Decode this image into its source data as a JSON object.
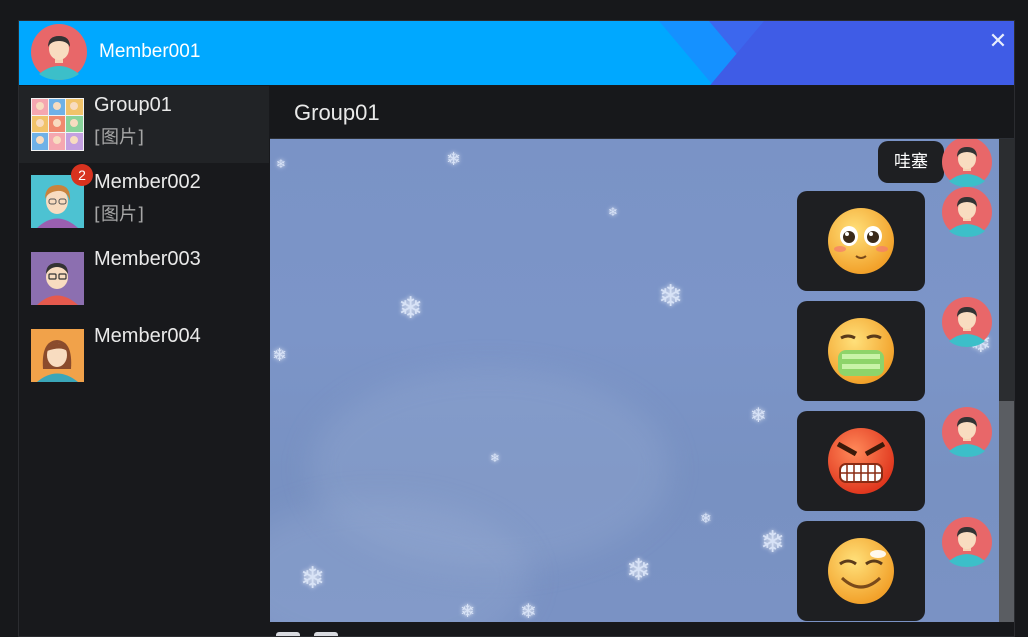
{
  "header": {
    "title": "Member001",
    "close_icon": "close-icon",
    "colors": {
      "primary": "#00a8ff",
      "accent": "#3c67ee"
    }
  },
  "sidebar": {
    "contacts": [
      {
        "name": "Group01",
        "last_message": "[图片]",
        "unread": "",
        "avatar": "group-avatar-icon",
        "active": true
      },
      {
        "name": "Member002",
        "last_message": "[图片]",
        "unread": "2",
        "avatar": "member-avatar-icon",
        "active": false
      },
      {
        "name": "Member003",
        "last_message": "",
        "unread": "",
        "avatar": "member-avatar-icon",
        "active": false
      },
      {
        "name": "Member004",
        "last_message": "",
        "unread": "",
        "avatar": "member-avatar-icon",
        "active": false
      }
    ]
  },
  "chat": {
    "title": "Group01",
    "messages": [
      {
        "type": "text",
        "text": "哇塞"
      },
      {
        "type": "emoji",
        "emoji": "pleading-face-emoji"
      },
      {
        "type": "emoji",
        "emoji": "sick-vomiting-emoji"
      },
      {
        "type": "emoji",
        "emoji": "angry-face-emoji"
      },
      {
        "type": "emoji",
        "emoji": "smug-grin-emoji"
      }
    ],
    "background": "snowflake-wallpaper"
  },
  "toolbar": {
    "items": [
      "emoji-icon",
      "folder-icon"
    ]
  }
}
